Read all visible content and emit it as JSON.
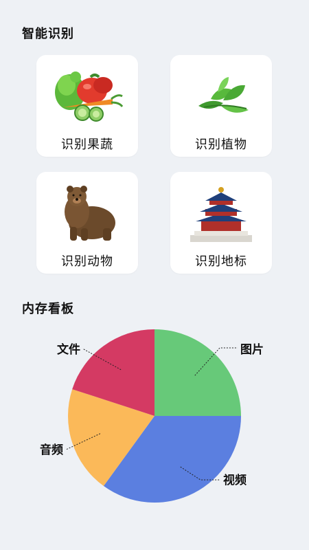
{
  "recognition": {
    "title": "智能识别",
    "cards": [
      {
        "label": "识别果蔬",
        "icon": "vegetables-icon"
      },
      {
        "label": "识别植物",
        "icon": "mint-leaves-icon"
      },
      {
        "label": "识别动物",
        "icon": "bear-icon"
      },
      {
        "label": "识别地标",
        "icon": "temple-of-heaven-icon"
      }
    ]
  },
  "storage": {
    "title": "内存看板"
  },
  "chart_data": {
    "type": "pie",
    "categories": [
      "图片",
      "视频",
      "音频",
      "文件"
    ],
    "values": [
      25,
      35,
      20,
      20
    ],
    "colors": [
      "#67c979",
      "#5b7fe0",
      "#fbb959",
      "#d43a63"
    ],
    "start_angle_deg": -90,
    "legend": "callout labels around pie"
  }
}
